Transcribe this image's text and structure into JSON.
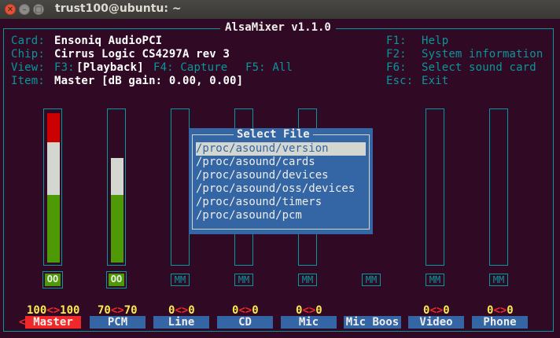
{
  "window": {
    "title": "trust100@ubuntu: ~",
    "close": "✕",
    "minimize": "–",
    "maximize": "□"
  },
  "header": {
    "app_title": "AlsaMixer v1.1.0",
    "card_label": "Card:",
    "card_value": "Ensoniq AudioPCI",
    "chip_label": "Chip:",
    "chip_value": "Cirrus Logic CS4297A rev 3",
    "view_label": "View:",
    "view_f3_key": "F3:",
    "view_f3_value": "[Playback]",
    "view_f4": "F4: Capture",
    "view_f5": "F5: All",
    "item_label": "Item:",
    "item_value": "Master [dB gain: 0.00, 0.00]",
    "help": [
      {
        "key": "F1:",
        "label": "Help"
      },
      {
        "key": "F2:",
        "label": "System information"
      },
      {
        "key": "F6:",
        "label": "Select sound card"
      },
      {
        "key": "Esc:",
        "label": "Exit"
      }
    ]
  },
  "channels": [
    {
      "name": "Master",
      "left": "100",
      "sep": "<>",
      "right": "100",
      "level": 1.0,
      "state": "OO",
      "selected": true
    },
    {
      "name": "PCM",
      "left": "70",
      "sep": "<>",
      "right": "70",
      "level": 0.7,
      "state": "OO",
      "selected": false
    },
    {
      "name": "Line",
      "left": "0",
      "sep": "<>",
      "right": "0",
      "level": 0,
      "state": "MM",
      "selected": false
    },
    {
      "name": "CD",
      "left": "0",
      "sep": "<>",
      "right": "0",
      "level": 0,
      "state": "MM",
      "selected": false
    },
    {
      "name": "Mic",
      "left": "0",
      "sep": "<>",
      "right": "0",
      "level": 0,
      "state": "MM",
      "selected": false
    },
    {
      "name": "Mic Boos",
      "left": "",
      "sep": "",
      "right": "",
      "level": 0,
      "state": "MM",
      "selected": false
    },
    {
      "name": "Video",
      "left": "0",
      "sep": "<>",
      "right": "0",
      "level": 0,
      "state": "MM",
      "selected": false
    },
    {
      "name": "Phone",
      "left": "0",
      "sep": "<>",
      "right": "0",
      "level": 0,
      "state": "MM",
      "selected": false
    }
  ],
  "selected_arrow": "<",
  "dialog": {
    "title": "Select File",
    "items": [
      "/proc/asound/version",
      "/proc/asound/cards",
      "/proc/asound/devices",
      "/proc/asound/oss/devices",
      "/proc/asound/timers",
      "/proc/asound/pcm"
    ],
    "selected_index": 0
  },
  "colors": {
    "background": "#300a24",
    "frame": "#06989a",
    "meter_green": "#4e9a06",
    "meter_white": "#d3d7cf",
    "meter_red": "#cc0000",
    "dialog": "#3465a4",
    "highlight": "#ef2929"
  }
}
